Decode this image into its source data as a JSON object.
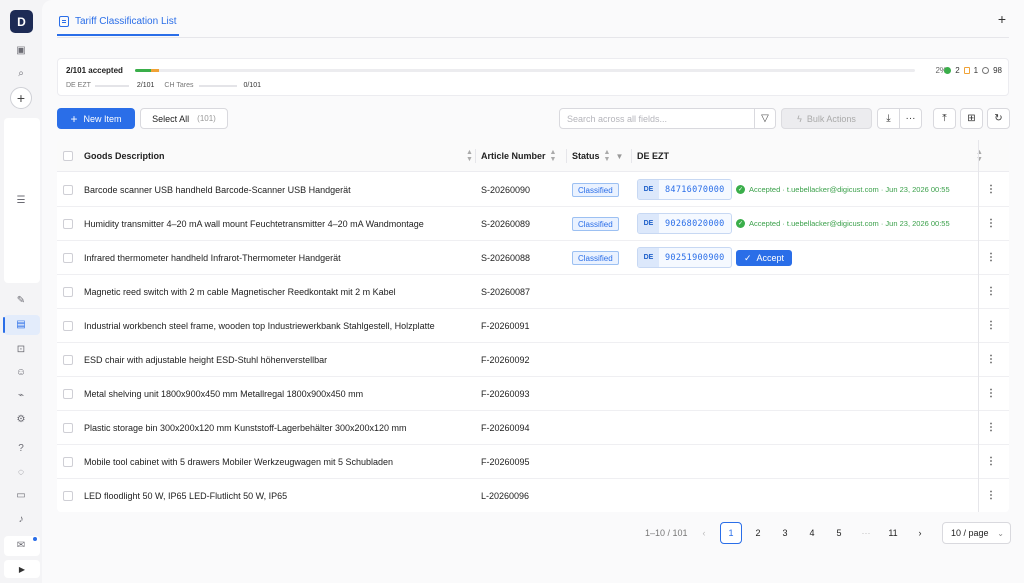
{
  "logo": {
    "letter": "D"
  },
  "tab": {
    "title": "Tariff Classification List",
    "add_label": "+"
  },
  "progress": {
    "accepted_text": "2/101 accepted",
    "accepted_fraction": 0.02,
    "classified_fraction": 0.01,
    "percent_text": "2%",
    "count_accepted": "2",
    "count_classified": "1",
    "count_pending": "98",
    "sub": [
      {
        "label": "DE EZT",
        "value": "2/101"
      },
      {
        "label": "CH Tares",
        "value": "0/101"
      }
    ]
  },
  "toolbar": {
    "new_label": "New Item",
    "select_all_label": "Select All",
    "select_all_count": "(101)",
    "search_placeholder": "Search across all fields...",
    "bulk_label": "Bulk Actions"
  },
  "columns": {
    "goods": "Goods Description",
    "article": "Article Number",
    "status": "Status",
    "de_ezt": "DE EZT"
  },
  "rows": [
    {
      "desc": "Barcode scanner USB handheld Barcode-Scanner USB Handgerät",
      "article": "S-20260090",
      "status": "Classified",
      "country": "DE",
      "code": "84716070000",
      "accepted": "Accepted · t.uebellacker@digicust.com · Jun 23, 2026 00:55"
    },
    {
      "desc": "Humidity transmitter 4–20 mA wall mount Feuchtetransmitter 4–20 mA Wandmontage",
      "article": "S-20260089",
      "status": "Classified",
      "country": "DE",
      "code": "90268020000",
      "accepted": "Accepted · t.uebellacker@digicust.com · Jun 23, 2026 00:55"
    },
    {
      "desc": "Infrared thermometer handheld Infrarot-Thermometer Handgerät",
      "article": "S-20260088",
      "status": "Classified",
      "country": "DE",
      "code": "90251900900",
      "accept_label": "Accept"
    },
    {
      "desc": "Magnetic reed switch with 2 m cable Magnetischer Reedkontakt mit 2 m Kabel",
      "article": "S-20260087"
    },
    {
      "desc": "Industrial workbench steel frame, wooden top Industriewerkbank Stahlgestell, Holzplatte",
      "article": "F-20260091"
    },
    {
      "desc": "ESD chair with adjustable height ESD-Stuhl höhenverstellbar",
      "article": "F-20260092"
    },
    {
      "desc": "Metal shelving unit 1800x900x450 mm Metallregal 1800x900x450 mm",
      "article": "F-20260093"
    },
    {
      "desc": "Plastic storage bin 300x200x120 mm Kunststoff-Lagerbehälter 300x200x120 mm",
      "article": "F-20260094"
    },
    {
      "desc": "Mobile tool cabinet with 5 drawers Mobiler Werkzeugwagen mit 5 Schubladen",
      "article": "F-20260095"
    },
    {
      "desc": "LED floodlight 50 W, IP65 LED-Flutlicht 50 W, IP65",
      "article": "L-20260096"
    }
  ],
  "pagination": {
    "range": "1–10 / 101",
    "pages": [
      "1",
      "2",
      "3",
      "4",
      "5"
    ],
    "ellipsis": "···",
    "last": "11",
    "page_size": "10 / page",
    "current": "1"
  },
  "colors": {
    "accent": "#2a6ee8",
    "success": "#3aae4a",
    "warning": "#f0a236"
  }
}
